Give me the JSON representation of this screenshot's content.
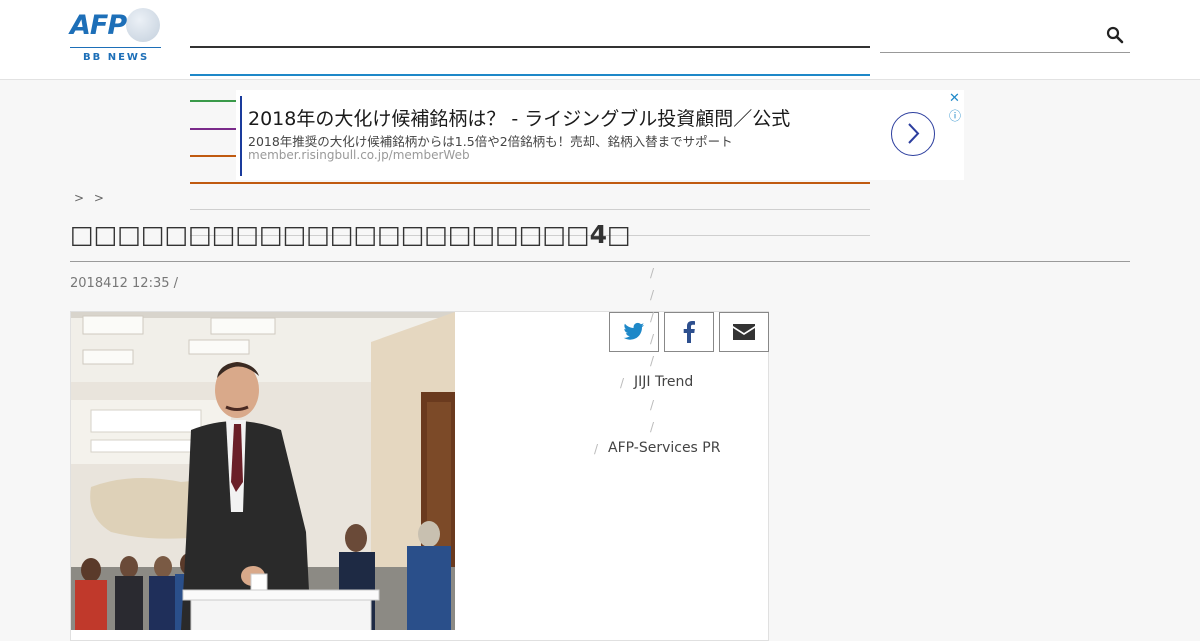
{
  "header": {
    "logo_text": "AFP",
    "logo_subtext": "BB NEWS",
    "nav_line_colors": [
      "#333333",
      "#1e88c8",
      "#3a9a4a",
      "#7a2a8a",
      "#c05a10",
      "#c05a10",
      "#cfcfcf",
      "#cfcfcf"
    ],
    "search_icon": "search-icon"
  },
  "ad": {
    "title": "2018年の大化け候補銘柄は？ - ライジングブル投資顧問／公式",
    "description": "2018年推奨の大化け候補銘柄からは1.5倍や2倍銘柄も！売却、銘柄入替までサポート",
    "url": "member.risingbull.co.jp/memberWeb",
    "close_icon": "close-icon",
    "info_icon": "info-icon",
    "go_icon": "chevron-right-icon"
  },
  "breadcrumb": "> >",
  "article": {
    "title": "□□□□□□□□□□□□□□□□□□□□□□4□",
    "date": "2018412 12:35  /",
    "photo_description": "man-voting-ballot-box"
  },
  "share": {
    "twitter_icon": "twitter-icon",
    "facebook_icon": "facebook-icon",
    "email_icon": "envelope-icon"
  },
  "related_sidebar": {
    "separator": "/",
    "items": [
      "JIJI Trend",
      "AFP-Services PR"
    ]
  },
  "colors": {
    "brand": "#1d6fb8",
    "accent": "#1e88c8"
  }
}
